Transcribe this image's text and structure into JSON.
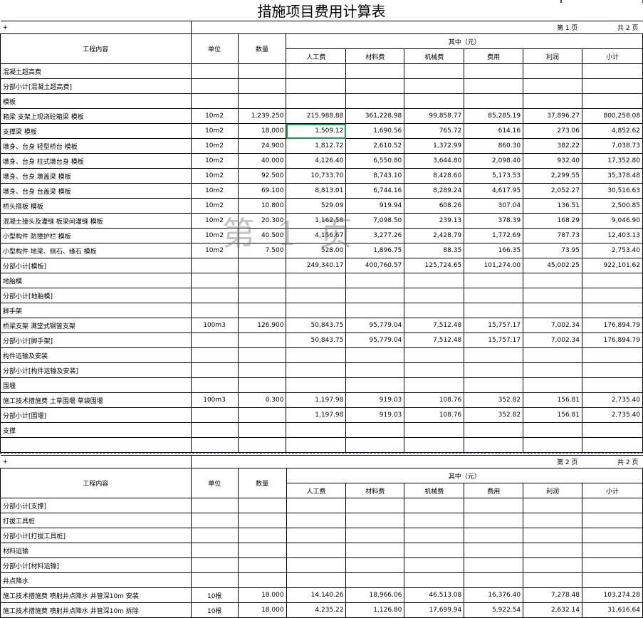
{
  "title": "措施项目费用计算表",
  "watermark": "第 1 页",
  "page1_label": "第 1 页",
  "page2_label": "第 2 页",
  "total_pages_label": "共 2 页",
  "row_marker": "+",
  "headers": {
    "item": "工程内容",
    "unit": "单位",
    "qty": "数量",
    "group": "其中（元）",
    "labor": "人工费",
    "material": "材料费",
    "machine": "机械费",
    "fee": "费用",
    "profit": "利润",
    "subtotal": "小计"
  },
  "rows_page1": [
    {
      "name": "混凝土超高费",
      "unit": "",
      "qty": "",
      "labor": "",
      "material": "",
      "machine": "",
      "fee": "",
      "profit": "",
      "subtotal": ""
    },
    {
      "name": "分部小计[混凝土超高费]",
      "unit": "",
      "qty": "",
      "labor": "",
      "material": "",
      "machine": "",
      "fee": "",
      "profit": "",
      "subtotal": ""
    },
    {
      "name": "模板",
      "unit": "",
      "qty": "",
      "labor": "",
      "material": "",
      "machine": "",
      "fee": "",
      "profit": "",
      "subtotal": ""
    },
    {
      "name": "箱梁 支架上现浇砼箱梁 模板",
      "unit": "10m2",
      "qty": "1,239.250",
      "labor": "215,988.88",
      "material": "361,228.98",
      "machine": "99,858.77",
      "fee": "85,285.19",
      "profit": "37,896.27",
      "subtotal": "800,258.08"
    },
    {
      "name": "支撑梁 模板",
      "unit": "10m2",
      "qty": "18.000",
      "labor": "1,509.12",
      "material": "1,690.56",
      "machine": "765.72",
      "fee": "614.16",
      "profit": "273.06",
      "subtotal": "4,852.62"
    },
    {
      "name": "墩身、台身 轻型桥台 模板",
      "unit": "10m2",
      "qty": "24.900",
      "labor": "1,812.72",
      "material": "2,610.52",
      "machine": "1,372.99",
      "fee": "860.30",
      "profit": "382.22",
      "subtotal": "7,038.73"
    },
    {
      "name": "墩身、台身 柱式墩台身 模板",
      "unit": "10m2",
      "qty": "40.000",
      "labor": "4,126.40",
      "material": "6,550.80",
      "machine": "3,644.80",
      "fee": "2,098.40",
      "profit": "932.40",
      "subtotal": "17,352.80"
    },
    {
      "name": "墩身、台身 墩盖梁 模板",
      "unit": "10m2",
      "qty": "92.500",
      "labor": "10,733.70",
      "material": "8,743.10",
      "machine": "8,428.60",
      "fee": "5,173.53",
      "profit": "2,299.55",
      "subtotal": "35,378.48"
    },
    {
      "name": "墩身、台身 台盖梁 模板",
      "unit": "10m2",
      "qty": "69.100",
      "labor": "8,813.01",
      "material": "6,744.16",
      "machine": "8,289.24",
      "fee": "4,617.95",
      "profit": "2,052.27",
      "subtotal": "30,516.63"
    },
    {
      "name": "桥头搭板 模板",
      "unit": "10m2",
      "qty": "10.800",
      "labor": "529.09",
      "material": "919.94",
      "machine": "608.26",
      "fee": "307.04",
      "profit": "136.51",
      "subtotal": "2,500.85"
    },
    {
      "name": "混凝土接头及灌缝 板梁间灌缝 模板",
      "unit": "10m2",
      "qty": "20.300",
      "labor": "1,162.58",
      "material": "7,098.50",
      "machine": "239.13",
      "fee": "378.39",
      "profit": "168.29",
      "subtotal": "9,046.90"
    },
    {
      "name": "小型构件 防撞护栏 模板",
      "unit": "10m2",
      "qty": "40.500",
      "labor": "4,156.67",
      "material": "3,277.26",
      "machine": "2,428.79",
      "fee": "1,772.69",
      "profit": "787.73",
      "subtotal": "12,403.13"
    },
    {
      "name": "小型构件 地梁、侧石、缘石 模板",
      "unit": "10m2",
      "qty": "7.500",
      "labor": "528.00",
      "material": "1,896.75",
      "machine": "88.35",
      "fee": "166.35",
      "profit": "73.95",
      "subtotal": "2,753.40"
    },
    {
      "name": "分部小计[模板]",
      "unit": "",
      "qty": "",
      "labor": "249,340.17",
      "material": "400,760.57",
      "machine": "125,724.65",
      "fee": "101,274.00",
      "profit": "45,002.25",
      "subtotal": "922,101.62"
    },
    {
      "name": "地胎模",
      "unit": "",
      "qty": "",
      "labor": "",
      "material": "",
      "machine": "",
      "fee": "",
      "profit": "",
      "subtotal": ""
    },
    {
      "name": "分部小计[地胎模]",
      "unit": "",
      "qty": "",
      "labor": "",
      "material": "",
      "machine": "",
      "fee": "",
      "profit": "",
      "subtotal": ""
    },
    {
      "name": "脚手架",
      "unit": "",
      "qty": "",
      "labor": "",
      "material": "",
      "machine": "",
      "fee": "",
      "profit": "",
      "subtotal": ""
    },
    {
      "name": "桥梁支架 满堂式钢管支架",
      "unit": "100m3",
      "qty": "126.900",
      "labor": "50,843.75",
      "material": "95,779.04",
      "machine": "7,512.48",
      "fee": "15,757.17",
      "profit": "7,002.34",
      "subtotal": "176,894.79"
    },
    {
      "name": "分部小计[脚手架]",
      "unit": "",
      "qty": "",
      "labor": "50,843.75",
      "material": "95,779.04",
      "machine": "7,512.48",
      "fee": "15,757.17",
      "profit": "7,002.34",
      "subtotal": "176,894.79"
    },
    {
      "name": "构件运输及安装",
      "unit": "",
      "qty": "",
      "labor": "",
      "material": "",
      "machine": "",
      "fee": "",
      "profit": "",
      "subtotal": ""
    },
    {
      "name": "分部小计[构件运输及安装]",
      "unit": "",
      "qty": "",
      "labor": "",
      "material": "",
      "machine": "",
      "fee": "",
      "profit": "",
      "subtotal": ""
    },
    {
      "name": "围堰",
      "unit": "",
      "qty": "",
      "labor": "",
      "material": "",
      "machine": "",
      "fee": "",
      "profit": "",
      "subtotal": ""
    },
    {
      "name": "施工技术措施费 土草围堰 草袋围堰",
      "unit": "100m3",
      "qty": "0.300",
      "labor": "1,197.98",
      "material": "919.03",
      "machine": "108.76",
      "fee": "352.82",
      "profit": "156.81",
      "subtotal": "2,735.40"
    },
    {
      "name": "分部小计[围堰]",
      "unit": "",
      "qty": "",
      "labor": "1,197.98",
      "material": "919.03",
      "machine": "108.76",
      "fee": "352.82",
      "profit": "156.81",
      "subtotal": "2,735.40"
    },
    {
      "name": "支撑",
      "unit": "",
      "qty": "",
      "labor": "",
      "material": "",
      "machine": "",
      "fee": "",
      "profit": "",
      "subtotal": ""
    },
    {
      "name": "",
      "unit": "",
      "qty": "",
      "labor": "",
      "material": "",
      "machine": "",
      "fee": "",
      "profit": "",
      "subtotal": ""
    }
  ],
  "rows_page2": [
    {
      "name": "分部小计[支撑]",
      "unit": "",
      "qty": "",
      "labor": "",
      "material": "",
      "machine": "",
      "fee": "",
      "profit": "",
      "subtotal": ""
    },
    {
      "name": "打拔工具桩",
      "unit": "",
      "qty": "",
      "labor": "",
      "material": "",
      "machine": "",
      "fee": "",
      "profit": "",
      "subtotal": ""
    },
    {
      "name": "分部小计[打拔工具桩]",
      "unit": "",
      "qty": "",
      "labor": "",
      "material": "",
      "machine": "",
      "fee": "",
      "profit": "",
      "subtotal": ""
    },
    {
      "name": "材料运输",
      "unit": "",
      "qty": "",
      "labor": "",
      "material": "",
      "machine": "",
      "fee": "",
      "profit": "",
      "subtotal": ""
    },
    {
      "name": "分部小计[材料运输]",
      "unit": "",
      "qty": "",
      "labor": "",
      "material": "",
      "machine": "",
      "fee": "",
      "profit": "",
      "subtotal": ""
    },
    {
      "name": "井点降水",
      "unit": "",
      "qty": "",
      "labor": "",
      "material": "",
      "machine": "",
      "fee": "",
      "profit": "",
      "subtotal": ""
    },
    {
      "name": "施工技术措施费 喷射井点降水 井管深10m 安装",
      "unit": "10根",
      "qty": "18.000",
      "labor": "14,140.26",
      "material": "18,966.06",
      "machine": "46,513.08",
      "fee": "16,376.40",
      "profit": "7,278.48",
      "subtotal": "103,274.28"
    },
    {
      "name": "施工技术措施费 喷射井点降水 井管深10m 拆除",
      "unit": "10根",
      "qty": "18.000",
      "labor": "4,235.22",
      "material": "1,126.80",
      "machine": "17,699.94",
      "fee": "5,922.54",
      "profit": "2,632.14",
      "subtotal": "31,616.64"
    }
  ]
}
